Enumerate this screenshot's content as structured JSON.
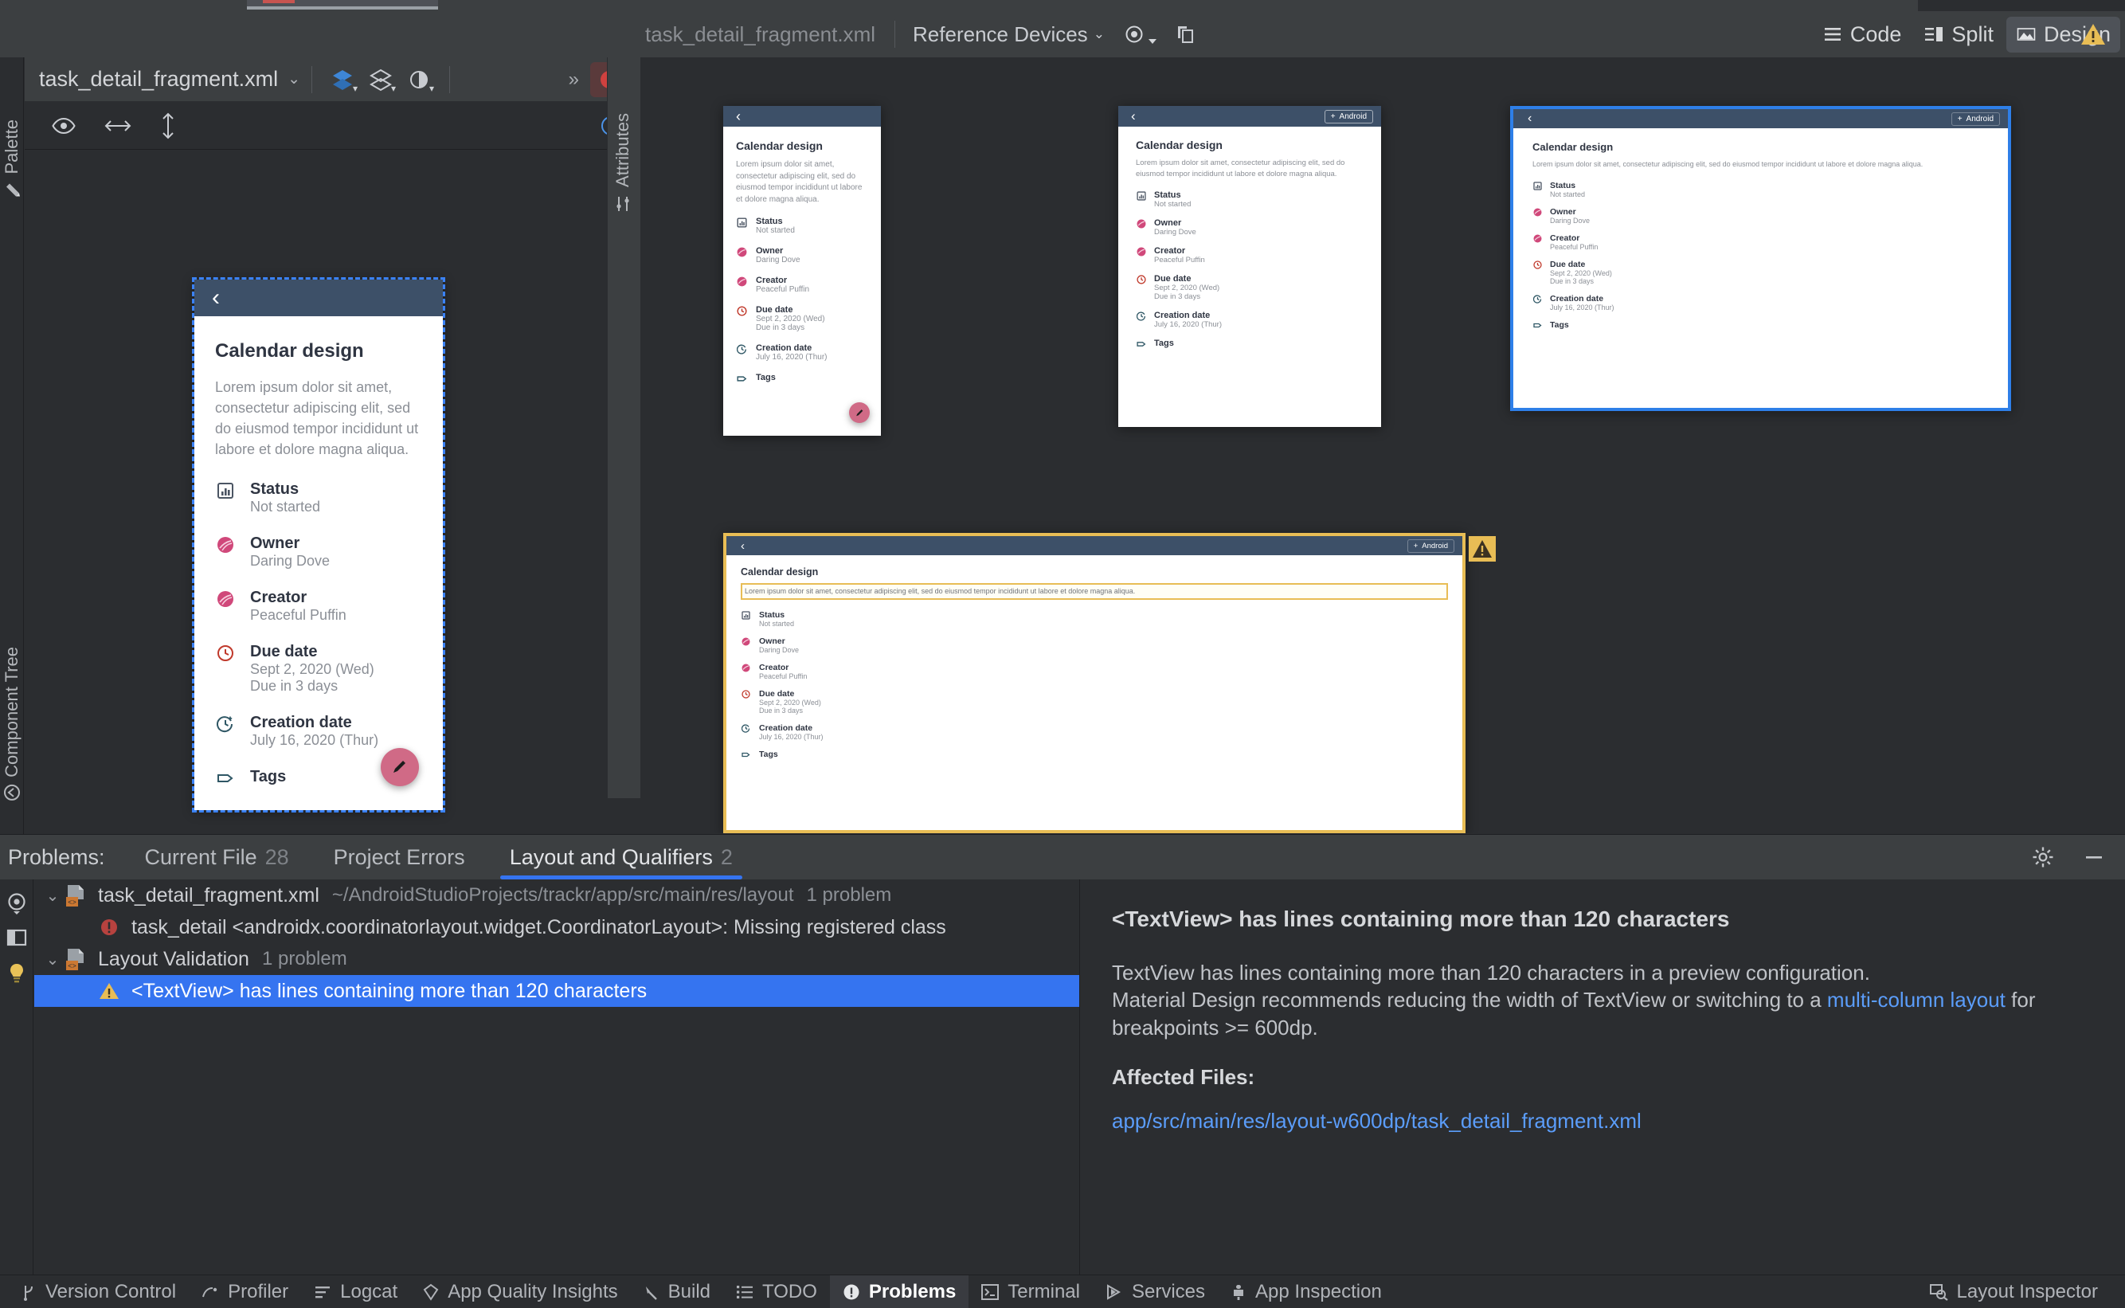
{
  "window": {
    "editor_modes": [
      {
        "label": "Code",
        "icon": "code-lines-icon",
        "active": false
      },
      {
        "label": "Split",
        "icon": "split-pane-icon",
        "active": false
      },
      {
        "label": "Design",
        "icon": "design-image-icon",
        "active": true
      }
    ],
    "preview_toolbar": {
      "file_chip": "task_detail_fragment.xml",
      "device_set": "Reference Devices",
      "device_set_caret": "⌄",
      "eye_icon": "visibility-eye-icon",
      "copy_icon": "duplicate-layouts-icon",
      "warning_icon": "warning-triangle-icon"
    }
  },
  "design_panel": {
    "filename": "task_detail_fragment.xml",
    "filename_caret": "⌄",
    "tools": [
      {
        "name": "layers-icon"
      },
      {
        "name": "blueprint-mode-icon"
      },
      {
        "name": "theme-contrast-icon"
      }
    ],
    "overflow_label": "»",
    "error_icon": "error-circle-icon",
    "attributes_panel_icon": "attributes-sliders-icon",
    "row2_tools": [
      {
        "name": "eye-icon"
      },
      {
        "name": "horizontal-resize-icon"
      },
      {
        "name": "vertical-resize-icon"
      }
    ],
    "help_icon": "help-question-icon"
  },
  "left_tool_tabs": [
    {
      "label": "Palette",
      "icon": "palette-icon"
    },
    {
      "label": "Component Tree",
      "icon": "component-tree-icon"
    }
  ],
  "right_tool_tabs": [
    {
      "label": "Attributes",
      "icon": "attributes-sliders-icon"
    }
  ],
  "screen_content": {
    "title": "Calendar design",
    "description": "Lorem ipsum dolor sit amet, consectetur adipiscing elit, sed do eiusmod tempor incididunt ut labore et dolore magna aliqua.",
    "back_chevron": "‹",
    "android_button": "Android",
    "android_button_plus": "+",
    "rows": [
      {
        "icon": "status-chart-icon",
        "label": "Status",
        "values": [
          "Not started"
        ]
      },
      {
        "icon": "owner-avatar-icon",
        "label": "Owner",
        "values": [
          "Daring Dove"
        ]
      },
      {
        "icon": "creator-avatar-icon",
        "label": "Creator",
        "values": [
          "Peaceful Puffin"
        ]
      },
      {
        "icon": "clock-due-icon",
        "label": "Due date",
        "values": [
          "Sept 2, 2020 (Wed)",
          "Due in 3 days"
        ]
      },
      {
        "icon": "clock-plus-icon",
        "label": "Creation date",
        "values": [
          "July 16, 2020 (Thur)"
        ]
      },
      {
        "icon": "tag-icon",
        "label": "Tags",
        "values": []
      }
    ],
    "fab_icon": "edit-pencil-icon"
  },
  "previews": [
    {
      "id": "preview-editor-phone",
      "selected": "dashed-blue",
      "show_android_button": false,
      "show_fab": true
    },
    {
      "id": "preview-phone-1",
      "selected": "none",
      "show_android_button": false,
      "show_fab": true
    },
    {
      "id": "preview-phone-2",
      "selected": "none",
      "show_android_button": true,
      "show_fab": false
    },
    {
      "id": "preview-tablet-wide",
      "selected": "solid-blue",
      "show_android_button": true,
      "show_fab": false
    },
    {
      "id": "preview-w600dp-warning",
      "selected": "yellow",
      "show_android_button": true,
      "show_fab": false,
      "warning_badge": "warning-triangle-icon",
      "textview_highlighted": true
    }
  ],
  "problems_panel": {
    "title": "Problems:",
    "tabs": [
      {
        "label": "Current File",
        "count": "28",
        "active": false
      },
      {
        "label": "Project Errors",
        "count": "",
        "active": false
      },
      {
        "label": "Layout and Qualifiers",
        "count": "2",
        "active": true
      }
    ],
    "gear_icon": "settings-gear-icon",
    "minimize_icon": "minimize-icon",
    "side_icons": [
      {
        "name": "inspection-target-icon"
      },
      {
        "name": "split-view-icon"
      },
      {
        "name": "lightbulb-icon"
      }
    ],
    "tree": [
      {
        "type": "file",
        "twisty": "⌄",
        "icon": "xml-file-icon",
        "label": "task_detail_fragment.xml",
        "path": "~/AndroidStudioProjects/trackr/app/src/main/res/layout",
        "count": "1 problem",
        "indent": 0,
        "selected": false
      },
      {
        "type": "problem",
        "severity": "error-circle-icon",
        "label": "task_detail <androidx.coordinatorlayout.widget.CoordinatorLayout>: Missing registered class",
        "indent": 1,
        "selected": false
      },
      {
        "type": "group",
        "twisty": "⌄",
        "icon": "xml-file-icon",
        "label": "Layout Validation",
        "count": "1 problem",
        "indent": 0,
        "selected": false
      },
      {
        "type": "problem",
        "severity": "warning-triangle-icon",
        "label": "<TextView> has lines containing more than 120 characters",
        "indent": 1,
        "selected": true
      }
    ],
    "detail": {
      "heading": "<TextView> has lines containing more than 120 characters",
      "body_1": "TextView has lines containing more than 120 characters in a preview configuration.",
      "body_2a": "Material Design recommends reducing the width of TextView or switching to a ",
      "body_link": "multi-column layout",
      "body_2b": " for breakpoints >= 600dp.",
      "affected_heading": "Affected Files:",
      "affected_file": "app/src/main/res/layout-w600dp/task_detail_fragment.xml"
    }
  },
  "status_bar": {
    "left_items": [
      {
        "label": "Version Control",
        "icon": "branch-icon",
        "active": false
      },
      {
        "label": "Profiler",
        "icon": "profiler-icon",
        "active": false
      },
      {
        "label": "Logcat",
        "icon": "logcat-icon",
        "active": false
      },
      {
        "label": "App Quality Insights",
        "icon": "diamond-icon",
        "active": false
      },
      {
        "label": "Build",
        "icon": "hammer-icon",
        "active": false
      },
      {
        "label": "TODO",
        "icon": "todo-list-icon",
        "active": false
      },
      {
        "label": "Problems",
        "icon": "problems-circle-icon",
        "active": true
      },
      {
        "label": "Terminal",
        "icon": "terminal-icon",
        "active": false
      },
      {
        "label": "Services",
        "icon": "services-play-icon",
        "active": false
      },
      {
        "label": "App Inspection",
        "icon": "app-inspection-icon",
        "active": false
      }
    ],
    "right_items": [
      {
        "label": "Layout Inspector",
        "icon": "layout-inspector-icon",
        "active": false
      }
    ]
  },
  "colors": {
    "accent_blue": "#3574f0",
    "appbar_navy": "#3d5068",
    "fab_pink": "#d06a86",
    "warning_yellow": "#e8bd55",
    "error_red": "#c75450",
    "selection_blue": "#2e7fe8"
  }
}
